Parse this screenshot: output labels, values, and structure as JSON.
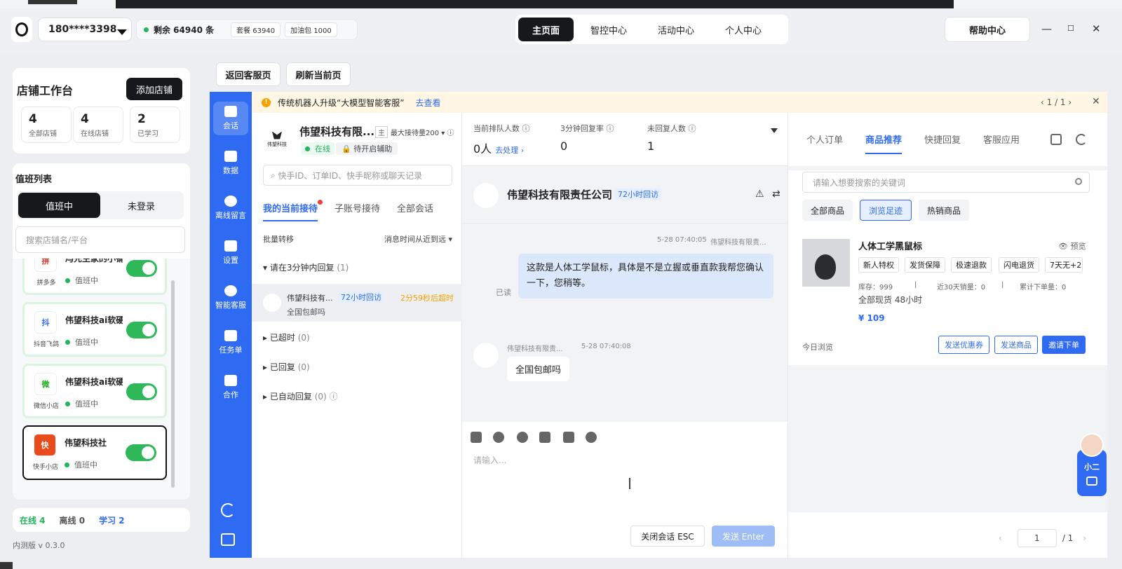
{
  "header": {
    "phone": "180****3398",
    "remaining": "剩余 64940 条",
    "package": "套餐 63940",
    "addon": "加油包 1000",
    "nav": [
      "主页面",
      "智控中心",
      "活动中心",
      "个人中心"
    ],
    "help": "帮助中心"
  },
  "workspace": {
    "title": "店铺工作台",
    "add_store": "添加店铺",
    "stats": [
      {
        "value": "4",
        "label": "全部店铺"
      },
      {
        "value": "4",
        "label": "在线店铺"
      },
      {
        "value": "2",
        "label": "已学习"
      }
    ]
  },
  "duty": {
    "title": "值班列表",
    "seg_on": "值班中",
    "seg_off": "未登录",
    "search_placeholder": "搜索店铺名/平台",
    "stores": [
      {
        "name": "冯先生家的小铺",
        "platform": "拼多多",
        "status": "值班中",
        "icon": "拼"
      },
      {
        "name": "伟望科技ai软硬",
        "platform": "抖音飞鸽",
        "status": "值班中",
        "icon": "抖"
      },
      {
        "name": "伟望科技ai软硬",
        "platform": "微信小店",
        "status": "值班中",
        "icon": "微"
      },
      {
        "name": "伟望科技社",
        "platform": "快手小店",
        "status": "值班中",
        "icon": "快"
      }
    ]
  },
  "legend": {
    "online": "在线 4",
    "offline": "离线 0",
    "learn": "学习 2"
  },
  "version": "内测版 v 0.3.0",
  "toolbar": {
    "back": "返回客服页",
    "refresh": "刷新当前页"
  },
  "vnav": [
    "会话",
    "数据",
    "离线留言",
    "设置",
    "智能客服",
    "任务单",
    "合作"
  ],
  "banner": {
    "text": "传统机器人升级“大模型智能客服”",
    "link": "去查看",
    "pager": "1 / 1"
  },
  "session": {
    "shop_name": "伟望科技有限...",
    "main_tag": "主",
    "max_recv": "最大接待量200",
    "online": "在线",
    "assist": "待开启辅助",
    "logo_text": "伟望科技",
    "search_placeholder": "快手ID、订单ID、快手昵称或聊天记录",
    "tabs": [
      "我的当前接待",
      "子账号接待",
      "全部会话"
    ],
    "batch": "批量转移",
    "sort": "消息时间从近到远",
    "group_reply": "请在3分钟内回复",
    "group_reply_count": "(1)",
    "item": {
      "name": "伟望科技有...",
      "tag": "72小时回访",
      "timeout": "2分59秒后超时",
      "msg": "全国包邮吗"
    },
    "groups": [
      {
        "label": "已超时",
        "count": "(0)"
      },
      {
        "label": "已回复",
        "count": "(0)"
      },
      {
        "label": "已自动回复",
        "count": "(0)"
      }
    ]
  },
  "queue": [
    {
      "label": "当前排队人数",
      "value": "0人",
      "sub": "去处理"
    },
    {
      "label": "3分钟回复率",
      "value": "0",
      "sub": ""
    },
    {
      "label": "未回复人数",
      "value": "1",
      "sub": ""
    }
  ],
  "chat": {
    "name": "伟望科技有限责任公司",
    "tag": "72小时回访",
    "out_time": "5-28 07:40:05",
    "out_sender": "伟望科技有限责...",
    "out_msg": "这款是人体工学鼠标，具体是不是立握或垂直款我帮您确认一下，您稍等。",
    "read": "已读",
    "in_sender": "伟望科技有限责...",
    "in_time": "5-28 07:40:08",
    "in_msg": "全国包邮吗",
    "placeholder": "请输入...",
    "close": "关闭会话 ESC",
    "send": "发送 Enter"
  },
  "right": {
    "tabs": [
      "个人订单",
      "商品推荐",
      "快捷回复",
      "客服应用"
    ],
    "search_placeholder": "请输入想要搜索的关键词",
    "filters": [
      "全部商品",
      "浏览足迹",
      "热销商品"
    ],
    "product": {
      "name": "人体工学黑鼠标",
      "preview": "预览",
      "tags": [
        "新人特权",
        "发货保障",
        "极速退款",
        "闪电退货",
        "7天无+2"
      ],
      "stock": "库存：999",
      "sales": "近30天销量：0",
      "orders": "累计下单量：0",
      "delivery": "全部现货 48小时",
      "price": "¥ 109"
    },
    "today": "今日浏览",
    "buttons": [
      "发送优惠券",
      "发送商品",
      "邀请下单"
    ],
    "page": "1",
    "total": "/ 1"
  },
  "helper": {
    "label": "小二"
  }
}
